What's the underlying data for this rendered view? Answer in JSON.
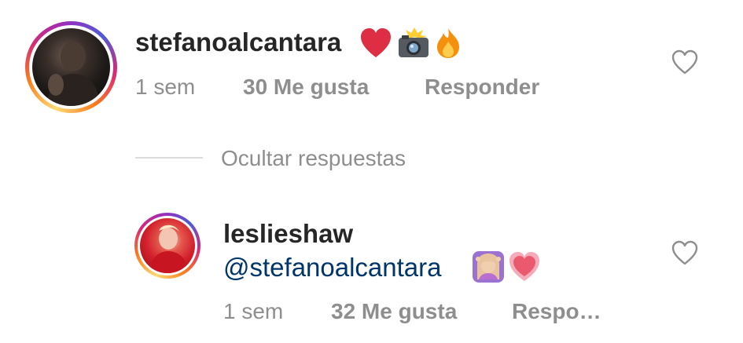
{
  "comments": [
    {
      "username": "stefanoalcantara",
      "emojis": [
        "heart-emoji",
        "camera-flash-emoji",
        "fire-emoji"
      ],
      "time": "1 sem",
      "likes": "30 Me gusta",
      "reply": "Responder"
    }
  ],
  "replies_toggle": "Ocultar respuestas",
  "replies": [
    {
      "username": "leslieshaw",
      "mention": "@stefanoalcantara",
      "emojis": [
        "person-gesturing-ok-emoji",
        "growing-heart-emoji"
      ],
      "time": "1 sem",
      "likes": "32 Me gusta",
      "reply": "Respo…"
    }
  ],
  "colors": {
    "username": "#262626",
    "meta": "#8e8e8e",
    "mention": "#003569",
    "divider": "#dbdbdb"
  }
}
